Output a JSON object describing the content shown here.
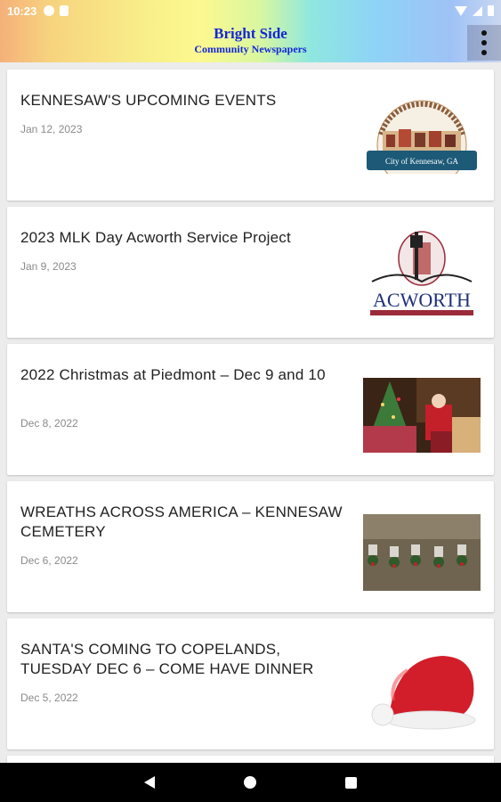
{
  "status_bar": {
    "time": "10:23"
  },
  "header": {
    "title": "Bright Side",
    "subtitle": "Community Newspapers"
  },
  "articles": [
    {
      "title": "KENNESAW'S UPCOMING EVENTS",
      "date": "Jan 12, 2023",
      "thumb_text": "City of Kennesaw, GA"
    },
    {
      "title": "2023 MLK Day Acworth Service Project",
      "date": "Jan 9, 2023",
      "thumb_text": "ACWORTH"
    },
    {
      "title": "2022 Christmas at Piedmont – Dec 9 and 10",
      "date": "Dec 8, 2022"
    },
    {
      "title": "WREATHS ACROSS AMERICA – KENNESAW CEMETERY",
      "date": "Dec 6, 2022"
    },
    {
      "title": "SANTA'S COMING TO COPELANDS, TUESDAY DEC 6 – COME HAVE DINNER",
      "date": "Dec 5, 2022"
    }
  ],
  "colors": {
    "brand_text": "#1427d9",
    "card_bg": "#ffffff",
    "page_bg": "#ececec"
  },
  "icons": [
    "wifi-icon",
    "signal-icon",
    "battery-icon",
    "more-vert-icon",
    "back-icon",
    "home-icon",
    "recents-icon"
  ]
}
